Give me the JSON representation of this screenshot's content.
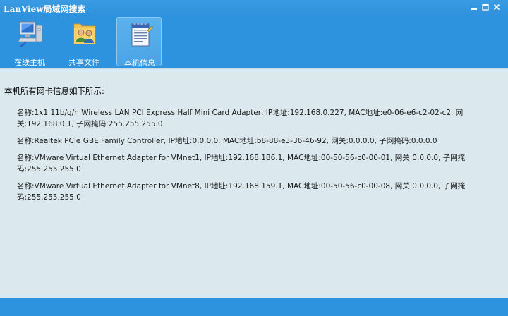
{
  "window": {
    "title": "LanView局域网搜索"
  },
  "title_buttons": {
    "minimize": "−",
    "maximize": "□",
    "close": "×"
  },
  "toolbar": {
    "items": [
      {
        "label": "在线主机",
        "icon": "computer-icon",
        "active": false
      },
      {
        "label": "共享文件",
        "icon": "shared-users-icon",
        "active": false
      },
      {
        "label": "本机信息",
        "icon": "notepad-icon",
        "active": true
      }
    ]
  },
  "content": {
    "heading": "本机所有网卡信息如下所示:",
    "adapters": [
      "名称:1x1 11b/g/n Wireless LAN PCI Express Half Mini Card Adapter, IP地址:192.168.0.227, MAC地址:e0-06-e6-c2-02-c2, 网关:192.168.0.1, 子网掩码:255.255.255.0",
      "名称:Realtek PCIe GBE Family Controller, IP地址:0.0.0.0, MAC地址:b8-88-e3-36-46-92, 网关:0.0.0.0, 子网掩码:0.0.0.0",
      "名称:VMware Virtual Ethernet Adapter for VMnet1, IP地址:192.168.186.1, MAC地址:00-50-56-c0-00-01, 网关:0.0.0.0, 子网掩码:255.255.255.0",
      "名称:VMware Virtual Ethernet Adapter for VMnet8, IP地址:192.168.159.1, MAC地址:00-50-56-c0-00-08, 网关:0.0.0.0, 子网掩码:255.255.255.0"
    ]
  },
  "colors": {
    "chrome_blue": "#2e93de",
    "content_background": "#dbe9ef",
    "active_tool": "#4aa4e6"
  }
}
